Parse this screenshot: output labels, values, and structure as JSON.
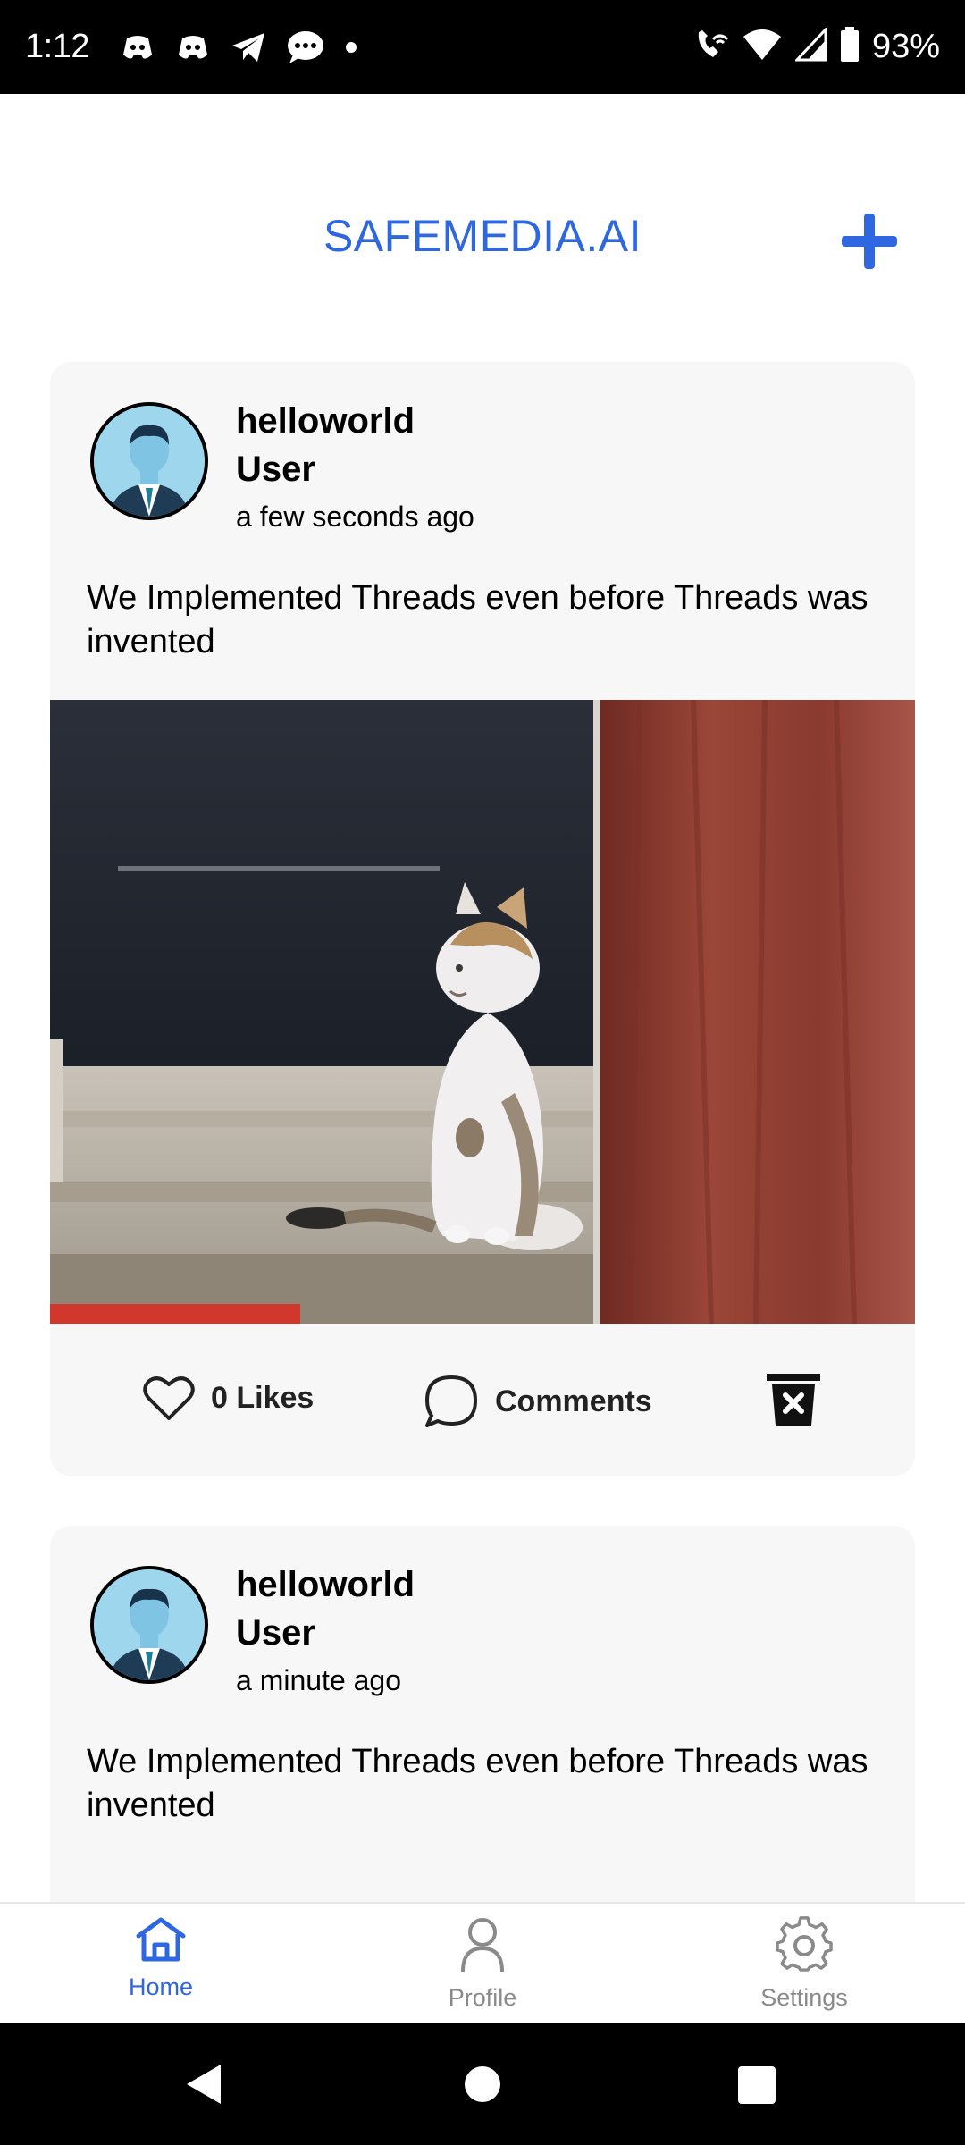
{
  "status_bar": {
    "time": "1:12",
    "battery": "93%",
    "icons_left": [
      "discord-icon",
      "discord-icon",
      "telegram-icon",
      "chat-bubble-icon",
      "dot-icon"
    ],
    "icons_right": [
      "wifi-call-icon",
      "wifi-icon",
      "signal-icon",
      "battery-icon"
    ]
  },
  "header": {
    "title": "SAFEMEDIA.AI",
    "add_icon": "plus-icon",
    "accent_color": "#2f67e0"
  },
  "posts": [
    {
      "username": "helloworld",
      "role": "User",
      "timestamp": "a few seconds ago",
      "text": "We Implemented Threads even before Threads was invented",
      "likes_label": "0 Likes",
      "comments_label": "Comments",
      "has_image": true
    },
    {
      "username": "helloworld",
      "role": "User",
      "timestamp": "a minute ago",
      "text": "We Implemented Threads even before Threads was invented"
    }
  ],
  "bottom_nav": {
    "items": [
      {
        "label": "Home",
        "icon": "home-icon",
        "active": true
      },
      {
        "label": "Profile",
        "icon": "person-icon",
        "active": false
      },
      {
        "label": "Settings",
        "icon": "gear-icon",
        "active": false
      }
    ]
  }
}
